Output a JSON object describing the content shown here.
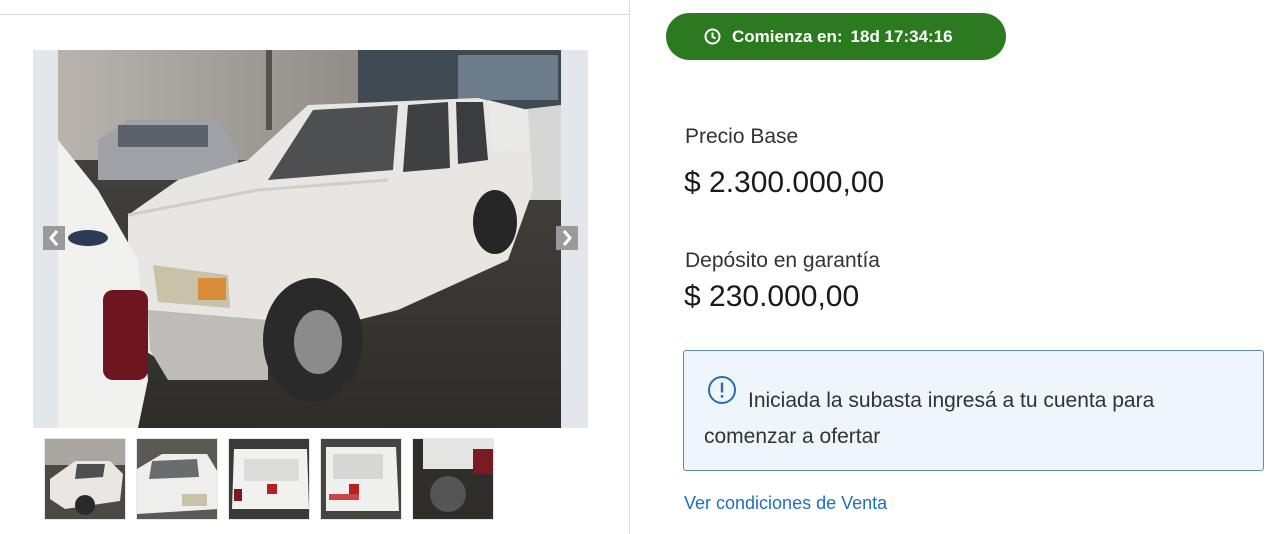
{
  "countdown": {
    "label": "Comienza en:",
    "value": "18d 17:34:16",
    "icon": "clock-icon",
    "color": "#2b7a1f"
  },
  "price": {
    "label": "Precio Base",
    "value": "$ 2.300.000,00"
  },
  "deposit": {
    "label": "Depósito en garantía",
    "value": "$ 230.000,00"
  },
  "notice": {
    "icon": "info-icon",
    "text": "Iniciada la subasta ingresá a tu cuenta para comenzar a ofertar"
  },
  "conditions_link": "Ver condiciones de Venta",
  "gallery": {
    "prev_icon": "chevron-left-icon",
    "next_icon": "chevron-right-icon",
    "thumbnail_count": 5
  },
  "colors": {
    "accent_link": "#1f6fc5",
    "notice_border": "#5f8db5",
    "notice_bg": "#eef5fb"
  }
}
